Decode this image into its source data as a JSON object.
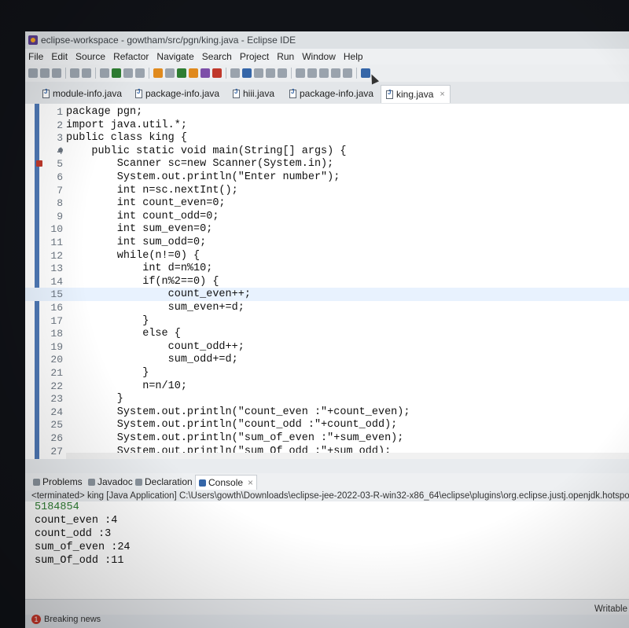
{
  "window": {
    "title": "eclipse-workspace - gowtham/src/pgn/king.java - Eclipse IDE"
  },
  "menu": [
    "File",
    "Edit",
    "Source",
    "Refactor",
    "Navigate",
    "Search",
    "Project",
    "Run",
    "Window",
    "Help"
  ],
  "tabs": [
    {
      "label": "module-info.java",
      "active": false
    },
    {
      "label": "package-info.java",
      "active": false
    },
    {
      "label": "hiii.java",
      "active": false
    },
    {
      "label": "package-info.java",
      "active": false
    },
    {
      "label": "king.java",
      "active": true,
      "close": "×"
    }
  ],
  "editor": {
    "lines": [
      {
        "n": "1",
        "code": "package pgn;"
      },
      {
        "n": "2",
        "code": "import java.util.*;"
      },
      {
        "n": "3",
        "code": "public class king {"
      },
      {
        "n": "4",
        "code": "    public static void main(String[] args) {",
        "fold": true
      },
      {
        "n": "5",
        "code": "        Scanner sc=new Scanner(System.in);",
        "bp": true
      },
      {
        "n": "6",
        "code": "        System.out.println(\"Enter number\");"
      },
      {
        "n": "7",
        "code": "        int n=sc.nextInt();"
      },
      {
        "n": "8",
        "code": "        int count_even=0;"
      },
      {
        "n": "9",
        "code": "        int count_odd=0;"
      },
      {
        "n": "10",
        "code": "        int sum_even=0;"
      },
      {
        "n": "11",
        "code": "        int sum_odd=0;"
      },
      {
        "n": "12",
        "code": "        while(n!=0) {"
      },
      {
        "n": "13",
        "code": "            int d=n%10;"
      },
      {
        "n": "14",
        "code": "            if(n%2==0) {"
      },
      {
        "n": "15",
        "code": "                count_even++;",
        "current": true
      },
      {
        "n": "16",
        "code": "                sum_even+=d;"
      },
      {
        "n": "17",
        "code": "            }"
      },
      {
        "n": "18",
        "code": "            else {"
      },
      {
        "n": "19",
        "code": "                count_odd++;"
      },
      {
        "n": "20",
        "code": "                sum_odd+=d;"
      },
      {
        "n": "21",
        "code": "            }"
      },
      {
        "n": "22",
        "code": "            n=n/10;"
      },
      {
        "n": "23",
        "code": "        }"
      },
      {
        "n": "24",
        "code": "        System.out.println(\"count_even :\"+count_even);"
      },
      {
        "n": "25",
        "code": "        System.out.println(\"count_odd :\"+count_odd);"
      },
      {
        "n": "26",
        "code": "        System.out.println(\"sum_of_even :\"+sum_even);"
      },
      {
        "n": "27",
        "code": "        System.out.println(\"sum_Of_odd :\"+sum_odd);"
      }
    ]
  },
  "console_tabs": [
    {
      "label": "Problems",
      "active": false
    },
    {
      "label": "Javadoc",
      "active": false
    },
    {
      "label": "Declaration",
      "active": false
    },
    {
      "label": "Console",
      "active": true,
      "close": "×"
    }
  ],
  "console": {
    "terminated": "<terminated> king [Java Application] C:\\Users\\gowth\\Downloads\\eclipse-jee-2022-03-R-win32-x86_64\\eclipse\\plugins\\org.eclipse.justj.openjdk.hotspot.jre.full.w",
    "input": "5184854",
    "output": [
      "count_even :4",
      "count_odd :3",
      "sum_of_even :24",
      "sum_Of_odd :11"
    ]
  },
  "status": {
    "writable": "Writable"
  },
  "taskbar": {
    "news": "Breaking news",
    "news_badge": "1"
  }
}
